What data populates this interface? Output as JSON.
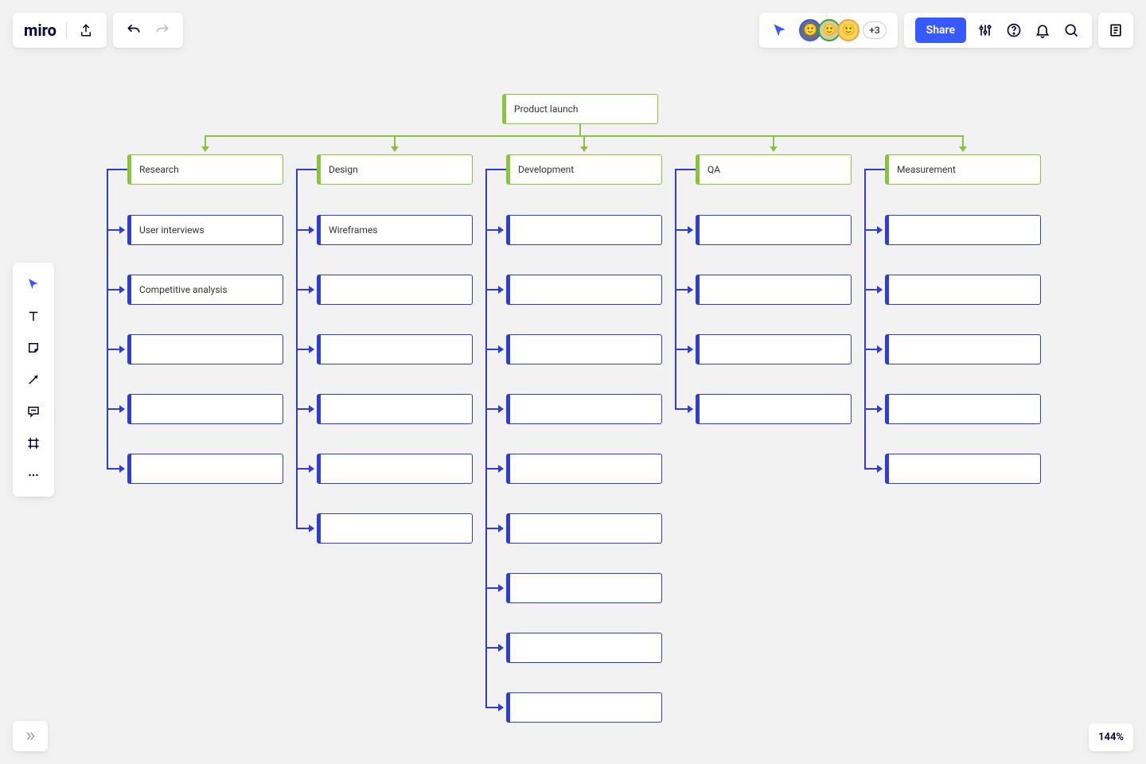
{
  "app": {
    "name": "miro"
  },
  "collab": {
    "extra_count": "+3",
    "share_label": "Share"
  },
  "zoom": {
    "level": "144%"
  },
  "avatars": [
    {
      "ring": "#3859ff",
      "bg": "#6d6d6d"
    },
    {
      "ring": "#2aa841",
      "bg": "#d9c9a3"
    },
    {
      "ring": "#f5a623",
      "bg": "#f3d16a"
    }
  ],
  "diagram": {
    "root": {
      "label": "Product launch"
    },
    "columns": [
      {
        "label": "Research",
        "items": [
          "User interviews",
          "Competitive analysis",
          "",
          "",
          ""
        ]
      },
      {
        "label": "Design",
        "items": [
          "Wireframes",
          "",
          "",
          "",
          "",
          ""
        ]
      },
      {
        "label": "Development",
        "items": [
          "",
          "",
          "",
          "",
          "",
          "",
          "",
          "",
          ""
        ]
      },
      {
        "label": "QA",
        "items": [
          "",
          "",
          "",
          ""
        ]
      },
      {
        "label": "Measurement",
        "items": [
          "",
          "",
          "",
          "",
          ""
        ]
      }
    ]
  }
}
